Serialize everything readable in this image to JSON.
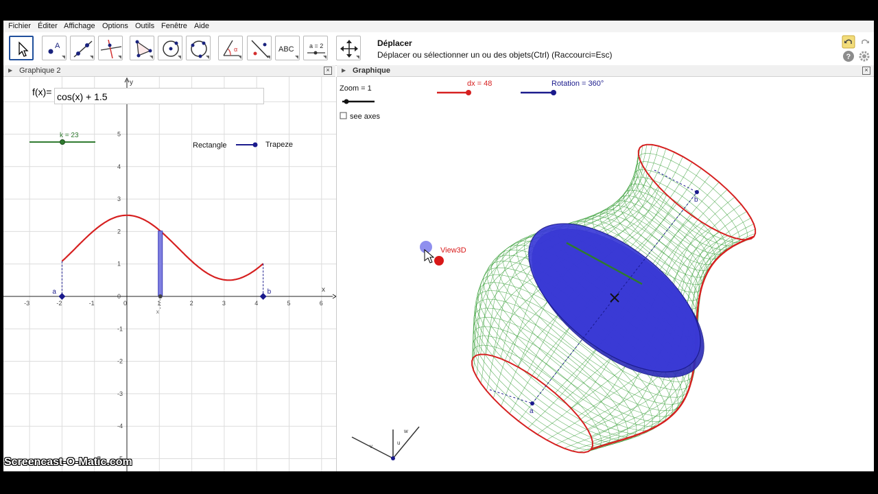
{
  "menu": [
    "Fichier",
    "Éditer",
    "Affichage",
    "Options",
    "Outils",
    "Fenêtre",
    "Aide"
  ],
  "toolbar": {
    "tools": [
      {
        "name": "move-tool",
        "label": ""
      },
      {
        "name": "point-tool",
        "label": "A"
      },
      {
        "name": "line-tool",
        "label": ""
      },
      {
        "name": "perpendicular-tool",
        "label": ""
      },
      {
        "name": "polygon-tool",
        "label": ""
      },
      {
        "name": "circle-center-tool",
        "label": ""
      },
      {
        "name": "circle-three-points-tool",
        "label": ""
      },
      {
        "name": "angle-tool",
        "label": "α"
      },
      {
        "name": "reflect-tool",
        "label": ""
      },
      {
        "name": "text-tool",
        "label": "ABC"
      },
      {
        "name": "slider-tool",
        "label": "a = 2"
      },
      {
        "name": "move-graphics-tool",
        "label": ""
      }
    ],
    "title": "Déplacer",
    "description": "Déplacer ou sélectionner un ou des objets(Ctrl) (Raccourci=Esc)"
  },
  "graphique2": {
    "header": "Graphique 2",
    "input_label": "f(x)=",
    "input_value": "cos(x) + 1.5",
    "slider_label": "k = 23",
    "k": 23,
    "rectangle_label": "Rectangle",
    "trapeze_label": "Trapeze",
    "point_a": "a",
    "point_b": "b",
    "axis_x_label": "x",
    "axis_y_label": "y",
    "x_marker": "x",
    "x_ticks": [
      "-3",
      "-2",
      "-1",
      "0",
      "1",
      "2",
      "3",
      "4",
      "5",
      "6"
    ],
    "y_ticks": [
      "5",
      "4",
      "3",
      "2",
      "1",
      "0",
      "-1",
      "-2",
      "-3",
      "-4",
      "-5"
    ],
    "colors": {
      "curve": "#d62020",
      "slider": "#2f7a2f",
      "trapeze": "#1a1a8c",
      "bar": "#8080e0"
    }
  },
  "graphique": {
    "header": "Graphique",
    "zoom_label": "Zoom = 1",
    "zoom": 1,
    "dx_label": "dx = 48",
    "dx": 48,
    "rotation_label": "Rotation = 360°",
    "rotation": 360,
    "see_axes_label": "see axes",
    "see_axes_checked": false,
    "view3d_label": "View3D",
    "point_a": "a",
    "point_b": "b",
    "axis_labels": [
      "v",
      "u",
      "w"
    ],
    "colors": {
      "mesh": "#2e9a2e",
      "rim": "#d62020",
      "disc": "#3a3ad8",
      "dx_slider": "#d62020",
      "rotation_slider": "#1a1a8c"
    }
  },
  "watermark": "Screencast-O-Matic.com"
}
